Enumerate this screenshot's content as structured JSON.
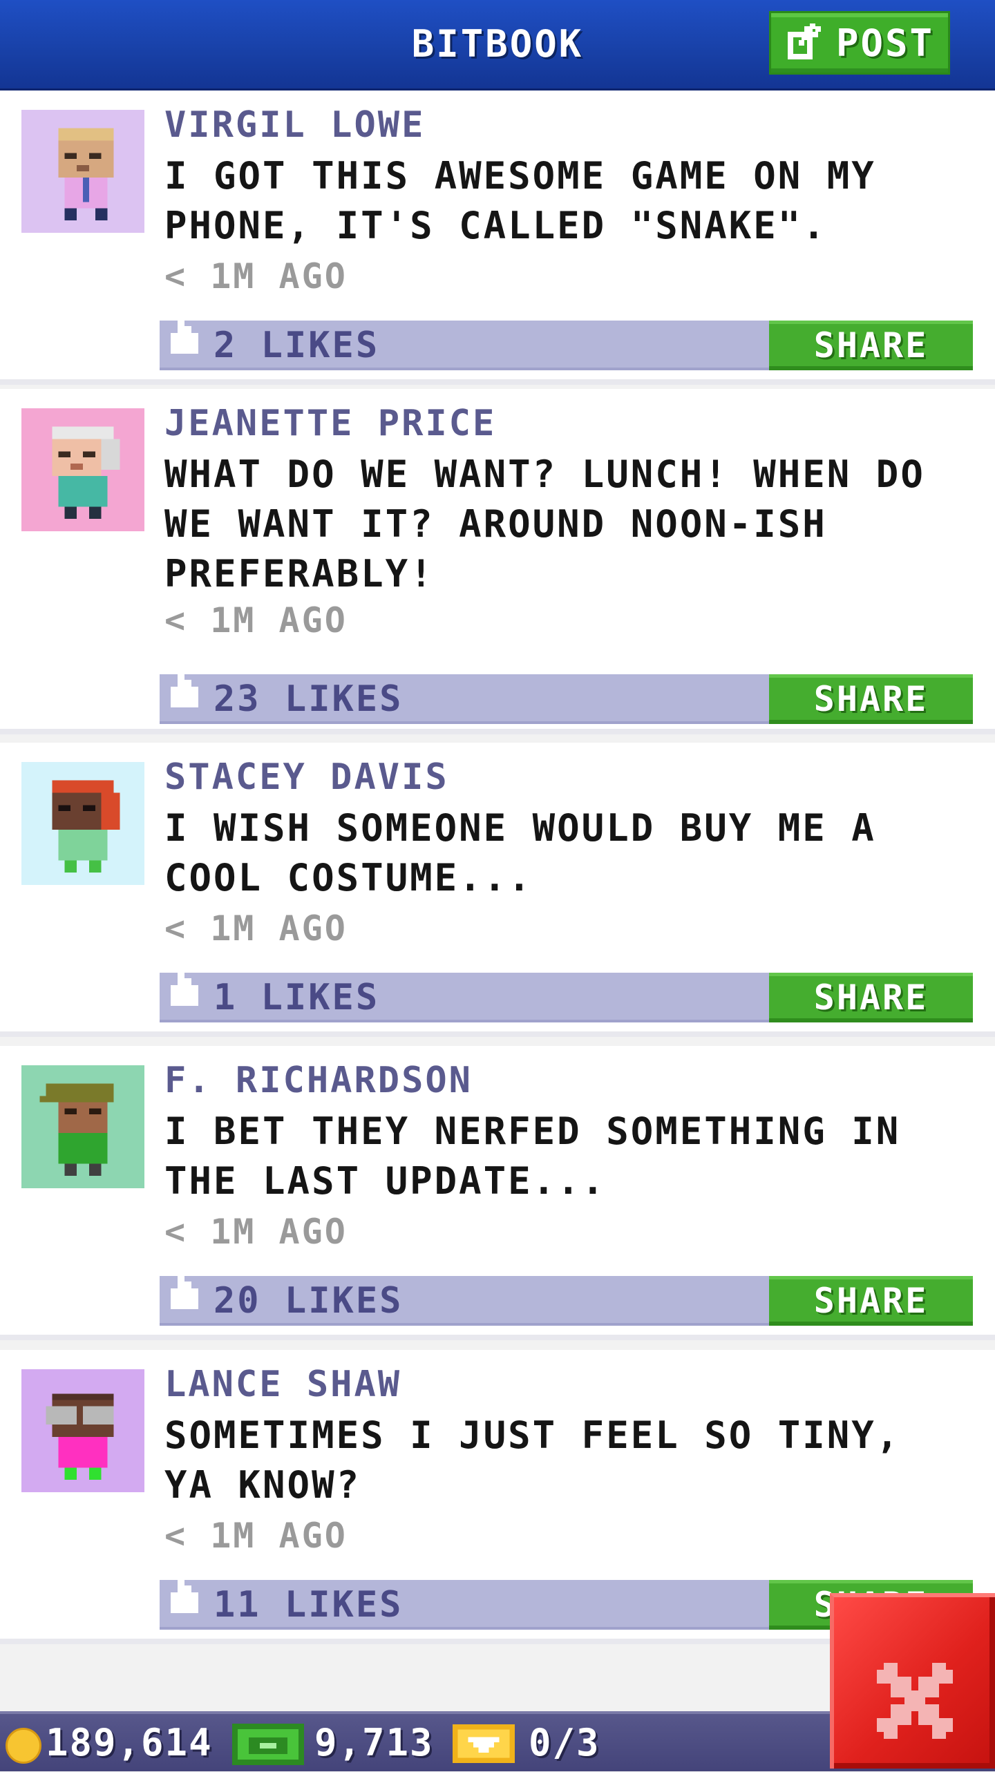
{
  "header": {
    "title": "BITBOOK",
    "post_label": "POST"
  },
  "posts": [
    {
      "author": "VIRGIL LOWE",
      "text": "I GOT THIS AWESOME GAME ON MY PHONE, IT'S CALLED \"SNAKE\".",
      "time": "< 1M AGO",
      "likes": "2 LIKES",
      "share_label": "SHARE",
      "avatar_bg": "#dcc3f2"
    },
    {
      "author": "JEANETTE PRICE",
      "text": "WHAT DO WE WANT? LUNCH! WHEN DO WE WANT IT? AROUND NOON-ISH PREFERABLY!",
      "time": "< 1M AGO",
      "likes": "23 LIKES",
      "share_label": "SHARE",
      "avatar_bg": "#f4a6d2"
    },
    {
      "author": "STACEY DAVIS",
      "text": "I WISH SOMEONE WOULD BUY ME A COOL COSTUME...",
      "time": "< 1M AGO",
      "likes": "1 LIKES",
      "share_label": "SHARE",
      "avatar_bg": "#d4f3fb"
    },
    {
      "author": "F. RICHARDSON",
      "text": "I BET THEY NERFED SOMETHING IN THE LAST UPDATE...",
      "time": "< 1M AGO",
      "likes": "20 LIKES",
      "share_label": "SHARE",
      "avatar_bg": "#8dd6b1"
    },
    {
      "author": "LANCE SHAW",
      "text": "SOMETIMES I JUST FEEL SO TINY, YA KNOW?",
      "time": "< 1M AGO",
      "likes": "11 LIKES",
      "share_label": "SHARE",
      "avatar_bg": "#d3aaf1"
    }
  ],
  "footer": {
    "coins": "189,614",
    "bux": "9,713",
    "tickets": "0/3"
  },
  "colors": {
    "header": "#1840a6",
    "share_green": "#45ad2f",
    "like_bar": "#b4b6d9",
    "close_red": "#e0211d"
  },
  "icons": {
    "post": "edit-icon",
    "like": "thumbs-up-icon",
    "coin": "coin-icon",
    "bux": "bux-icon",
    "ticket": "vip-ticket-icon",
    "close": "close-icon"
  }
}
